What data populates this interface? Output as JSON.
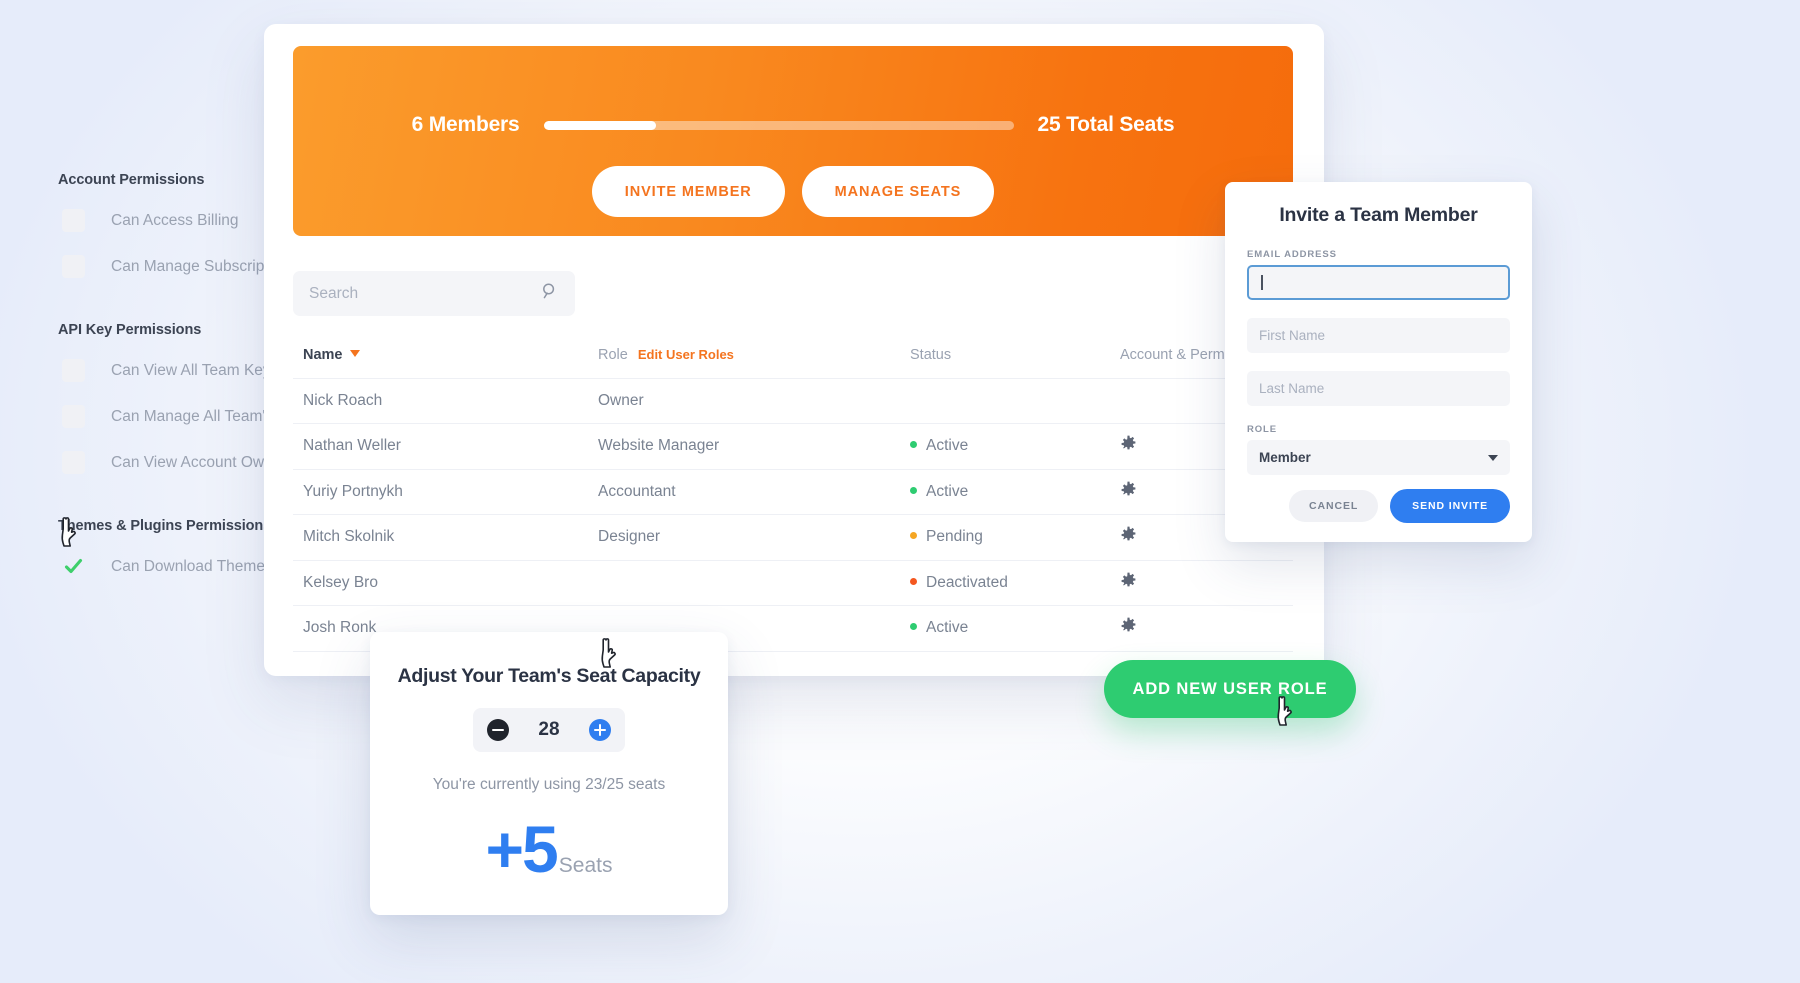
{
  "permissions": {
    "groups": [
      {
        "title": "Account Permissions",
        "items": [
          {
            "label": "Can Access Billing",
            "checked": false
          },
          {
            "label": "Can Manage Subscriptions",
            "checked": false
          }
        ]
      },
      {
        "title": "API Key Permissions",
        "items": [
          {
            "label": "Can View All Team Keys",
            "checked": false
          },
          {
            "label": "Can Manage All Team's Keys",
            "checked": false
          },
          {
            "label": "Can View Account Owner's K",
            "checked": false
          }
        ]
      },
      {
        "title": "Themes & Plugins Permissions",
        "items": [
          {
            "label": "Can Download Themes & Plug",
            "checked": true
          }
        ]
      }
    ],
    "check_color": "#3ecf6b",
    "box_color": "#f0f1f5"
  },
  "hero": {
    "members_label": "6 Members",
    "total_seats_label": "25 Total Seats",
    "progress_percent": 24,
    "invite_button": "INVITE MEMBER",
    "manage_button": "MANAGE SEATS",
    "accent_start": "#fb9c2c",
    "accent_end": "#f56c0c",
    "button_text_color": "#f4741f"
  },
  "search": {
    "placeholder": "Search",
    "value": "",
    "icon": "search-icon"
  },
  "table": {
    "headers": {
      "name": "Name",
      "role": "Role",
      "edit_roles_link": "Edit User Roles",
      "status": "Status",
      "account": "Account & Perm"
    },
    "sort_icon": "caret-down-icon",
    "rows": [
      {
        "name": "Nick Roach",
        "role": "Owner",
        "status": "",
        "status_color": "",
        "gear": false
      },
      {
        "name": "Nathan Weller",
        "role": "Website Manager",
        "status": "Active",
        "status_color": "#2ecc71",
        "gear": true
      },
      {
        "name": "Yuriy Portnykh",
        "role": "Accountant",
        "status": "Active",
        "status_color": "#2ecc71",
        "gear": true
      },
      {
        "name": "Mitch Skolnik",
        "role": "Designer",
        "status": "Pending",
        "status_color": "#f5a623",
        "gear": true
      },
      {
        "name": "Kelsey Bro",
        "role": "",
        "status": "Deactivated",
        "status_color": "#f4571f",
        "gear": true
      },
      {
        "name": "Josh Ronk",
        "role": "",
        "status": "Active",
        "status_color": "#2ecc71",
        "gear": true
      }
    ]
  },
  "cta": {
    "label": "ADD NEW USER ROLE",
    "color": "#2ecc71"
  },
  "invite": {
    "title": "Invite a Team Member",
    "email_label": "EMAIL ADDRESS",
    "email_value": "",
    "first_name_placeholder": "First Name",
    "last_name_placeholder": "Last Name",
    "role_label": "ROLE",
    "role_value": "Member",
    "cancel_label": "CANCEL",
    "send_label": "SEND INVITE",
    "send_color": "#2f7ef0"
  },
  "seat_modal": {
    "title": "Adjust Your Team's Seat Capacity",
    "value": "28",
    "minus_icon": "minus-circle-icon",
    "plus_icon": "plus-circle-icon",
    "usage_text": "You're currently using 23/25 seats",
    "delta_value": "+5",
    "delta_unit": "Seats",
    "delta_color": "#2f7ef0"
  }
}
